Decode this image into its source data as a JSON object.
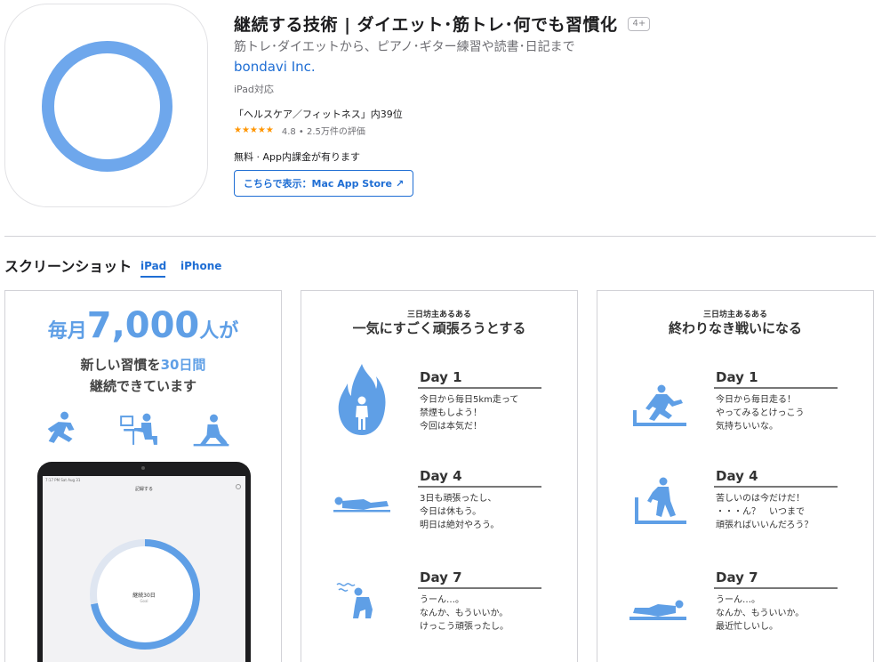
{
  "app": {
    "title": "継続する技術 | ダイエット･筋トレ･何でも習慣化",
    "age_rating": "4+",
    "subtitle": "筋トレ･ダイエットから、ピアノ･ギター練習や読書･日記まで",
    "developer": "bondavi Inc.",
    "device_support": "iPad対応",
    "ranking": "「ヘルスケア／フィットネス」内39位",
    "stars": "★★★★★",
    "rating_text": "4.8 • 2.5万件の評価",
    "price": "無料 · App内課金が有ります",
    "mac_store_button": "こちらで表示：Mac App Store",
    "mac_store_arrow": "↗",
    "icon_color": "#6ea7ec"
  },
  "screenshots": {
    "heading": "スクリーンショット",
    "tabs": [
      {
        "label": "iPad",
        "selected": true
      },
      {
        "label": "iPhone",
        "selected": false
      }
    ],
    "card1": {
      "hero_prefix": "毎月",
      "hero_number": "7,000",
      "hero_suffix": "人が",
      "line1_prefix": "新しい習慣を",
      "line1_highlight": "30日間",
      "line2": "継続できています",
      "tablet": {
        "status_left": "7:17 PM   Sat Aug 31",
        "nav_title": "記録する",
        "count_label": "継続30日",
        "count_sub": "Goal",
        "progress_fraction": 0.72
      }
    },
    "card2": {
      "kicker": "三日坊主あるある",
      "headline": "一気にすごく頑張ろうとする",
      "days": [
        {
          "label": "Day 1",
          "lines": [
            "今日から毎日5km走って",
            "禁煙もしよう！",
            "今回は本気だ！"
          ]
        },
        {
          "label": "Day 4",
          "lines": [
            "3日も頑張ったし、",
            "今日は休もう。",
            "明日は絶対やろう。"
          ]
        },
        {
          "label": "Day 7",
          "lines": [
            "うーん…。",
            "なんか、もういいか。",
            "けっこう頑張ったし。"
          ]
        }
      ]
    },
    "card3": {
      "kicker": "三日坊主あるある",
      "headline": "終わりなき戦いになる",
      "days": [
        {
          "label": "Day 1",
          "lines": [
            "今日から毎日走る！",
            "やってみるとけっこう",
            "気持ちいいな。"
          ]
        },
        {
          "label": "Day 4",
          "lines": [
            "苦しいのは今だけだ！",
            "・・・ん？　いつまで",
            "頑張ればいいんだろう？"
          ]
        },
        {
          "label": "Day 7",
          "lines": [
            "うーん…。",
            "なんか、もういいか。",
            "最近忙しいし。"
          ]
        }
      ]
    },
    "accent_color": "#5f9fe6"
  }
}
